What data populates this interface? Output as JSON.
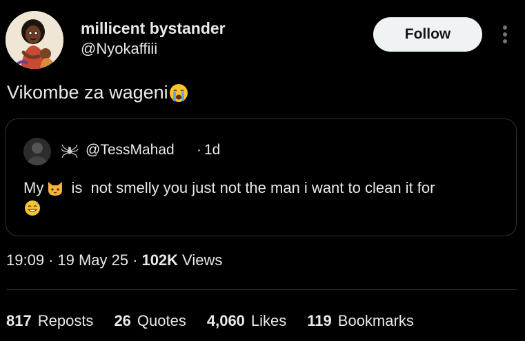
{
  "author": {
    "name": "millicent bystander",
    "handle": "@Nyokaffiii",
    "avatar_icon": "illustrated-avatar-icon"
  },
  "follow_button": {
    "label": "Follow"
  },
  "more_menu_icon": "more-vertical-icon",
  "tweet": {
    "text": "Vikombe za wageni",
    "emoji": "loudly-crying-face-icon"
  },
  "quote": {
    "handle": "@TessMahad",
    "separator": "·",
    "time": "1d",
    "name_icon": "spider-icon",
    "text_prefix": "My",
    "text_emoji": "cat-face-icon",
    "text_suffix": " is  not smelly you just not the man i want to clean it for",
    "trailing_emoji": "grinning-face-with-sweat-icon"
  },
  "meta": {
    "time": "19:09",
    "separator": "·",
    "date": "19 May 25",
    "views_count": "102K",
    "views_label": "Views"
  },
  "stats": {
    "reposts_count": "817",
    "reposts_label": "Reposts",
    "quotes_count": "26",
    "quotes_label": "Quotes",
    "likes_count": "4,060",
    "likes_label": "Likes",
    "bookmarks_count": "119",
    "bookmarks_label": "Bookmarks"
  },
  "colors": {
    "background": "#000000",
    "text": "#e7e9ea",
    "border": "#2f3336",
    "follow_bg": "#eff3f4",
    "follow_text": "#0f1419"
  }
}
